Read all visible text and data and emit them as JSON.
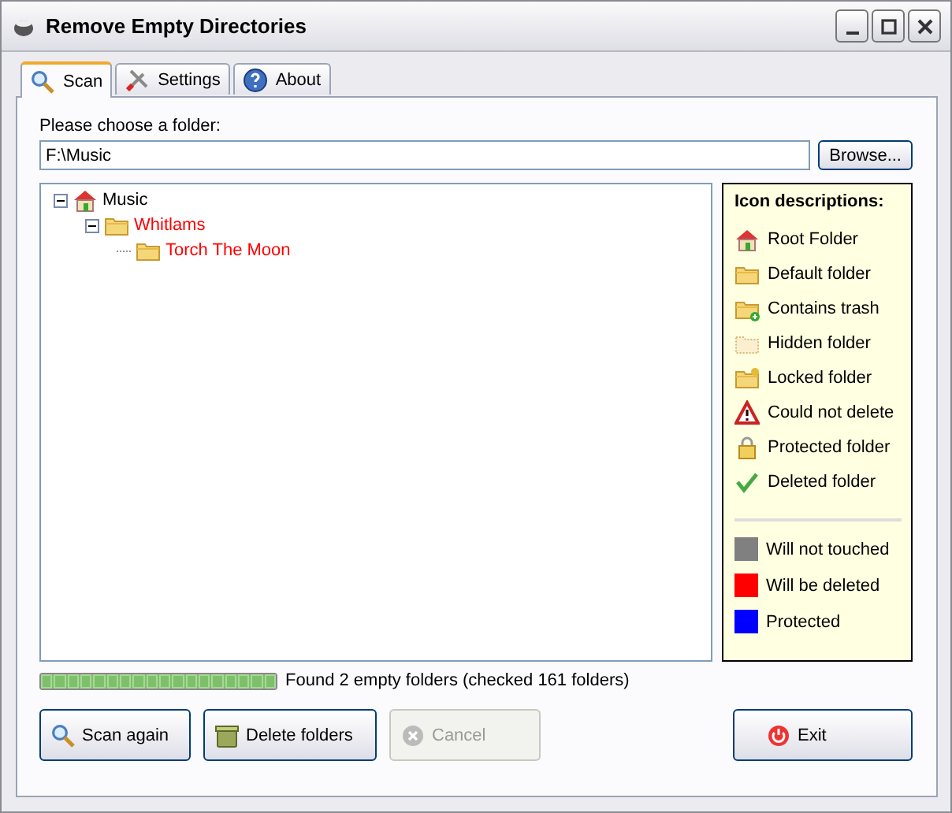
{
  "window": {
    "title": "Remove Empty Directories"
  },
  "tabs": [
    {
      "label": "Scan",
      "selected": true
    },
    {
      "label": "Settings",
      "selected": false
    },
    {
      "label": "About",
      "selected": false
    }
  ],
  "folder_label": "Please choose a folder:",
  "folder_field": {
    "value": "F:\\Music"
  },
  "browse_button": "Browse...",
  "tree": [
    {
      "label": "Music",
      "kind": "root",
      "color": "#000000",
      "expanded": true,
      "children": [
        {
          "label": "Whitlams",
          "kind": "folder",
          "color": "#ff0000",
          "expanded": true,
          "children": [
            {
              "label": "Torch The Moon",
              "kind": "folder",
              "color": "#ff0000"
            }
          ]
        }
      ]
    }
  ],
  "legend": {
    "title": "Icon descriptions:",
    "icons": [
      {
        "kind": "root",
        "label": "Root Folder"
      },
      {
        "kind": "folder",
        "label": "Default folder"
      },
      {
        "kind": "trash",
        "label": "Contains trash"
      },
      {
        "kind": "hidden",
        "label": "Hidden folder"
      },
      {
        "kind": "locked",
        "label": "Locked folder"
      },
      {
        "kind": "warning",
        "label": "Could not delete"
      },
      {
        "kind": "padlock",
        "label": "Protected folder"
      },
      {
        "kind": "check",
        "label": "Deleted folder"
      }
    ],
    "colors": [
      {
        "color": "#808080",
        "label": "Will not touched"
      },
      {
        "color": "#ff0000",
        "label": "Will be deleted"
      },
      {
        "color": "#0000ff",
        "label": "Protected"
      }
    ]
  },
  "progress": {
    "level": 1,
    "status": "Found 2 empty folders (checked 161 folders)"
  },
  "buttons": [
    {
      "label": "Scan again",
      "disabled": false
    },
    {
      "label": "Delete folders",
      "disabled": false
    },
    {
      "label": "Cancel",
      "disabled": true
    }
  ],
  "exit_button": {
    "label": "Exit",
    "disabled": false
  }
}
